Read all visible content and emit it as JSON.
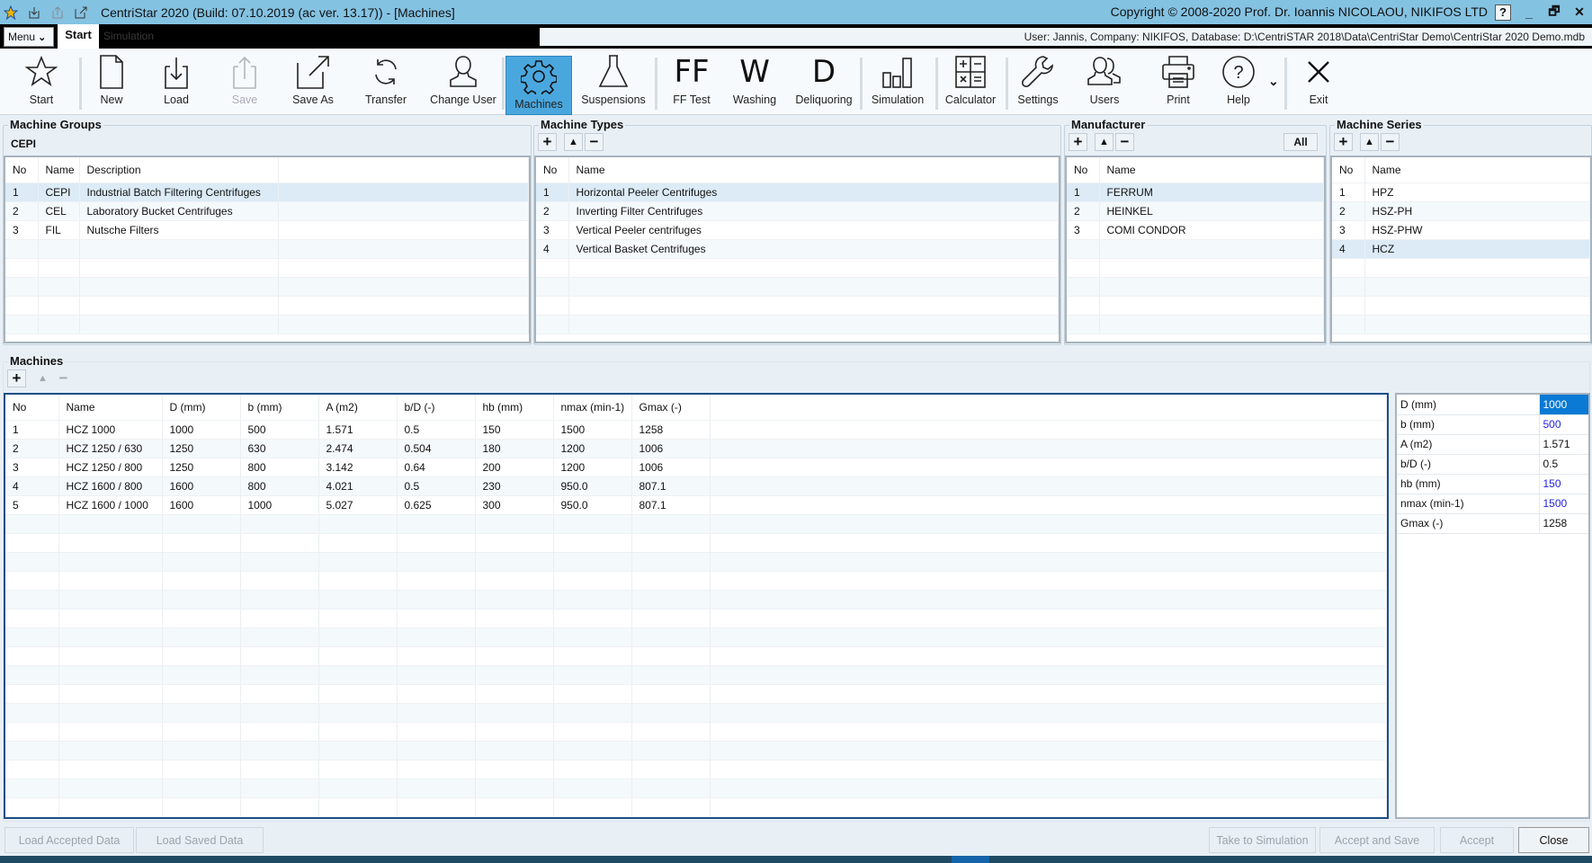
{
  "window": {
    "title": "CentriStar 2020 (Build: 07.10.2019 (ac ver. 13.17)) - [Machines]",
    "copyright": "Copyright © 2008-2020 Prof. Dr. Ioannis NICOLAOU, NIKIFOS LTD",
    "help_label": "?",
    "minimize_label": "_",
    "restore_label": "🗗",
    "close_label": "✕"
  },
  "tabbar": {
    "menu_label": "Menu",
    "tabs": [
      {
        "label": "Start",
        "active": true
      },
      {
        "label": "Simulation",
        "active": false
      }
    ],
    "info": "User: Jannis, Company: NIKIFOS, Database: D:\\CentriSTAR 2018\\Data\\CentriStar  Demo\\CentriStar 2020  Demo.mdb"
  },
  "ribbon": {
    "items": [
      {
        "label": "Start",
        "icon": "star-icon"
      },
      {
        "label": "New",
        "icon": "new-file-icon"
      },
      {
        "label": "Load",
        "icon": "load-icon"
      },
      {
        "label": "Save",
        "icon": "save-icon",
        "disabled": true
      },
      {
        "label": "Save As",
        "icon": "save-as-icon"
      },
      {
        "label": "Transfer",
        "icon": "transfer-icon"
      },
      {
        "label": "Change User",
        "icon": "user-icon"
      },
      {
        "label": "Machines",
        "icon": "gear-icon",
        "active": true
      },
      {
        "label": "Suspensions",
        "icon": "flask-icon"
      },
      {
        "label": "FF Test",
        "icon": "ff-text-icon",
        "glyph": "FF"
      },
      {
        "label": "Washing",
        "icon": "w-text-icon",
        "glyph": "W"
      },
      {
        "label": "Deliquoring",
        "icon": "d-text-icon",
        "glyph": "D"
      },
      {
        "label": "Simulation",
        "icon": "bar-chart-icon"
      },
      {
        "label": "Calculator",
        "icon": "calculator-icon"
      },
      {
        "label": "Settings",
        "icon": "wrench-icon"
      },
      {
        "label": "Users",
        "icon": "users-icon"
      },
      {
        "label": "Print",
        "icon": "printer-icon"
      },
      {
        "label": "Help",
        "icon": "help-icon"
      },
      {
        "label": "Exit",
        "icon": "close-icon"
      }
    ]
  },
  "machine_groups": {
    "legend": "Machine Groups",
    "current": "CEPI",
    "columns": [
      "No",
      "Name",
      "Description"
    ],
    "rows": [
      {
        "no": "1",
        "name": "CEPI",
        "description": "Industrial Batch Filtering Centrifuges",
        "selected": true
      },
      {
        "no": "2",
        "name": "CEL",
        "description": "Laboratory Bucket Centrifuges"
      },
      {
        "no": "3",
        "name": "FIL",
        "description": "Nutsche Filters"
      }
    ]
  },
  "machine_types": {
    "legend": "Machine Types",
    "columns": [
      "No",
      "Name"
    ],
    "rows": [
      {
        "no": "1",
        "name": "Horizontal Peeler Centrifuges",
        "selected": true
      },
      {
        "no": "2",
        "name": "Inverting Filter Centrifuges"
      },
      {
        "no": "3",
        "name": "Vertical Peeler centrifuges"
      },
      {
        "no": "4",
        "name": "Vertical Basket Centrifuges"
      }
    ]
  },
  "manufacturer": {
    "legend": "Manufacturer",
    "all_label": "All",
    "columns": [
      "No",
      "Name"
    ],
    "rows": [
      {
        "no": "1",
        "name": "FERRUM",
        "selected": true
      },
      {
        "no": "2",
        "name": "HEINKEL"
      },
      {
        "no": "3",
        "name": "COMI CONDOR"
      }
    ]
  },
  "machine_series": {
    "legend": "Machine Series",
    "columns": [
      "No",
      "Name"
    ],
    "rows": [
      {
        "no": "1",
        "name": "HPZ"
      },
      {
        "no": "2",
        "name": "HSZ-PH"
      },
      {
        "no": "3",
        "name": "HSZ-PHW"
      },
      {
        "no": "4",
        "name": "HCZ",
        "selected": true
      }
    ]
  },
  "machines": {
    "legend": "Machines",
    "columns": [
      "No",
      "Name",
      "D (mm)",
      "b (mm)",
      "A (m2)",
      "b/D (-)",
      "hb (mm)",
      "nmax (min-1)",
      "Gmax (-)"
    ],
    "rows": [
      [
        "1",
        "HCZ 1000",
        "1000",
        "500",
        "1.571",
        "0.5",
        "150",
        "1500",
        "1258"
      ],
      [
        "2",
        "HCZ 1250 / 630",
        "1250",
        "630",
        "2.474",
        "0.504",
        "180",
        "1200",
        "1006"
      ],
      [
        "3",
        "HCZ 1250 / 800",
        "1250",
        "800",
        "3.142",
        "0.64",
        "200",
        "1200",
        "1006"
      ],
      [
        "4",
        "HCZ 1600 / 800",
        "1600",
        "800",
        "4.021",
        "0.5",
        "230",
        "950.0",
        "807.1"
      ],
      [
        "5",
        "HCZ 1600 / 1000",
        "1600",
        "1000",
        "5.027",
        "0.625",
        "300",
        "950.0",
        "807.1"
      ]
    ]
  },
  "details": [
    {
      "label": "D (mm)",
      "value": "1000",
      "style": "highlight"
    },
    {
      "label": "b (mm)",
      "value": "500",
      "style": "blue"
    },
    {
      "label": "A (m2)",
      "value": "1.571",
      "style": "normal"
    },
    {
      "label": "b/D (-)",
      "value": "0.5",
      "style": "normal"
    },
    {
      "label": "hb (mm)",
      "value": "150",
      "style": "blue"
    },
    {
      "label": "nmax (min-1)",
      "value": "1500",
      "style": "blue"
    },
    {
      "label": "Gmax (-)",
      "value": "1258",
      "style": "normal"
    }
  ],
  "footer": {
    "load_accepted": "Load Accepted Data",
    "load_saved": "Load Saved Data",
    "take_to_simulation": "Take to Simulation",
    "accept_and_save": "Accept and Save",
    "accept": "Accept",
    "close": "Close"
  }
}
